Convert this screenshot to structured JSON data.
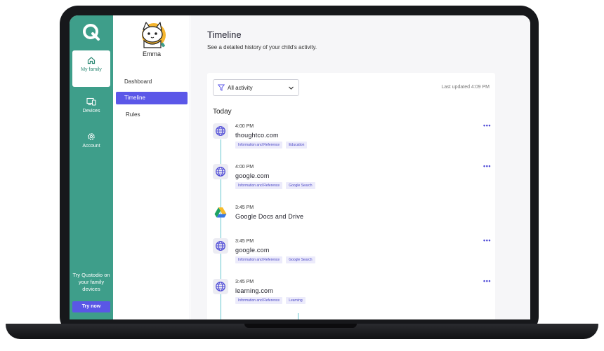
{
  "rail": {
    "items": [
      {
        "label": "My family",
        "icon": "home-icon"
      },
      {
        "label": "Devices",
        "icon": "devices-icon"
      },
      {
        "label": "Account",
        "icon": "gear-icon"
      }
    ],
    "promo_text": "Try Qustodio on your family devices",
    "try_label": "Try now"
  },
  "child": {
    "name": "Emma",
    "menu": [
      {
        "label": "Dashboard"
      },
      {
        "label": "Timeline"
      },
      {
        "label": "Rules"
      }
    ]
  },
  "main": {
    "title": "Timeline",
    "subtitle": "See a detailed history of your child's activity.",
    "filter": "All activity",
    "updated": "Last updated 4:09 PM",
    "section": "Today",
    "more_label": "•••",
    "entries": [
      {
        "time": "4:00 PM",
        "site": "thoughtco.com",
        "icon": "globe-icon",
        "tags": [
          "Information and Reference",
          "Education"
        ],
        "has_menu": true
      },
      {
        "time": "4:00 PM",
        "site": "google.com",
        "icon": "globe-icon",
        "tags": [
          "Information and Reference",
          "Google Search"
        ],
        "has_menu": true
      },
      {
        "time": "3:45 PM",
        "site": "Google Docs and Drive",
        "icon": "google-drive-icon",
        "tags": [],
        "has_menu": false
      },
      {
        "time": "3:45 PM",
        "site": "google.com",
        "icon": "globe-icon",
        "tags": [
          "Information and Reference",
          "Google Search"
        ],
        "has_menu": true
      },
      {
        "time": "3:45 PM",
        "site": "learning.com",
        "icon": "globe-icon",
        "tags": [
          "Information and Reference",
          "Learning"
        ],
        "has_menu": true
      }
    ]
  },
  "colors": {
    "rail": "#3e9e8a",
    "accent": "#5b57e8",
    "timeline": "#66c6cf"
  }
}
